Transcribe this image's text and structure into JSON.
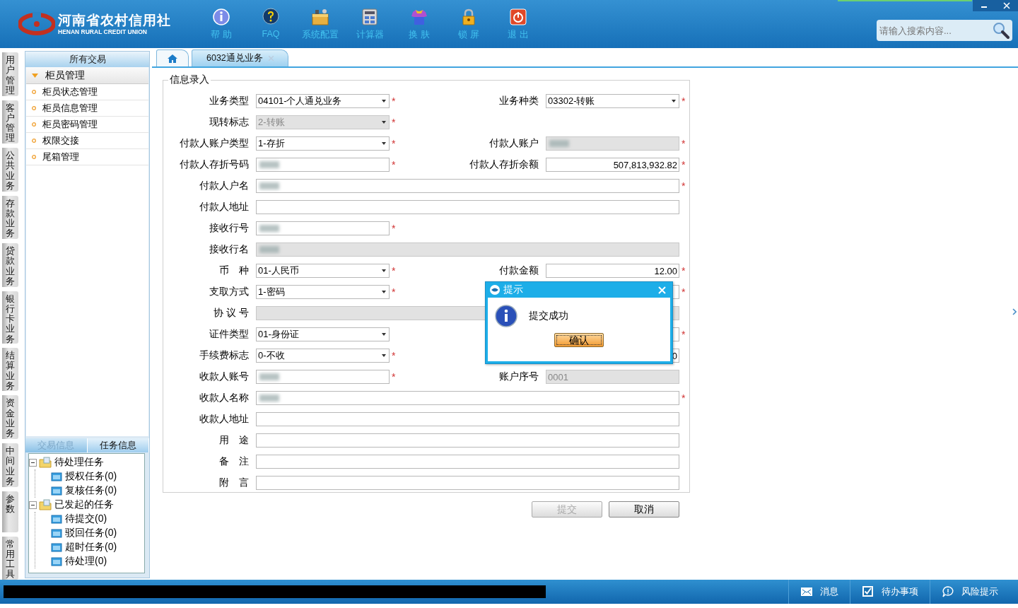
{
  "header": {
    "logo_title": "河南省农村信用社",
    "logo_subtitle": "HENAN RURAL CREDIT UNION",
    "toolbar": [
      {
        "label": "帮 助"
      },
      {
        "label": "FAQ"
      },
      {
        "label": "系统配置"
      },
      {
        "label": "计算器"
      },
      {
        "label": "换 肤"
      },
      {
        "label": "锁 屏"
      },
      {
        "label": "退 出"
      }
    ],
    "search": {
      "placeholder": "请输入搜索内容..."
    }
  },
  "side_tabs": [
    {
      "label": "用户管理"
    },
    {
      "label": "客户管理"
    },
    {
      "label": "公共业务"
    },
    {
      "label": "存款业务"
    },
    {
      "label": "贷款业务"
    },
    {
      "label": "银行卡业务"
    },
    {
      "label": "结算业务"
    },
    {
      "label": "资金业务"
    },
    {
      "label": "中间业务"
    },
    {
      "label": "参数"
    },
    {
      "label": "常用工具"
    }
  ],
  "nav": {
    "title": "所有交易",
    "group": {
      "label": "柜员管理",
      "expanded": true,
      "items": [
        {
          "label": "柜员状态管理"
        },
        {
          "label": "柜员信息管理"
        },
        {
          "label": "柜员密码管理"
        },
        {
          "label": "权限交接"
        },
        {
          "label": "尾箱管理"
        }
      ]
    }
  },
  "bottom_tabs": [
    {
      "label": "交易信息",
      "selected": false
    },
    {
      "label": "任务信息",
      "selected": true
    }
  ],
  "task_tree": [
    {
      "label": "待处理任务",
      "expanded": true,
      "children": [
        {
          "label": "授权任务(0)"
        },
        {
          "label": "复核任务(0)"
        }
      ]
    },
    {
      "label": "已发起的任务",
      "expanded": true,
      "children": [
        {
          "label": "待提交(0)"
        },
        {
          "label": "驳回任务(0)"
        },
        {
          "label": "超时任务(0)"
        },
        {
          "label": "待处理(0)"
        }
      ]
    }
  ],
  "tabs": [
    {
      "kind": "home",
      "selected": false
    },
    {
      "kind": "page",
      "label": "6032通兑业务",
      "selected": true
    }
  ],
  "form": {
    "legend": "信息录入",
    "rows": [
      {
        "kind": "pair",
        "left": {
          "label": "业务类型",
          "kind": "select",
          "value": "04101-个人通兑业务",
          "required_mark": "*",
          "disabled": false
        },
        "right": {
          "label": "业务种类",
          "kind": "select",
          "value": "03302-转账",
          "required_mark": "*",
          "disabled": false
        }
      },
      {
        "kind": "pair",
        "left": {
          "label": "现转标志",
          "kind": "select",
          "value": "2-转账",
          "required_mark": "*",
          "disabled": true
        }
      },
      {
        "kind": "pair",
        "left": {
          "label": "付款人账户类型",
          "kind": "select",
          "value": "1-存折",
          "required_mark": "*",
          "disabled": false
        },
        "right": {
          "label": "付款人账户",
          "kind": "text",
          "blurred": true,
          "required_mark": "*",
          "disabled": true
        }
      },
      {
        "kind": "pair",
        "left": {
          "label": "付款人存折号码",
          "kind": "text",
          "blurred": true,
          "required_mark": "*",
          "disabled": false
        },
        "right": {
          "label": "付款人存折余额",
          "kind": "amount",
          "value": "507,813,932.82",
          "required_mark": "*",
          "disabled": false
        }
      },
      {
        "kind": "wide",
        "field": {
          "label": "付款人户名",
          "kind": "text",
          "blurred": true,
          "required_mark": "*",
          "disabled": false
        }
      },
      {
        "kind": "wide",
        "field": {
          "label": "付款人地址",
          "kind": "text",
          "disabled": false
        }
      },
      {
        "kind": "pair",
        "left": {
          "label": "接收行号",
          "kind": "text",
          "blurred": true,
          "required_mark": "*",
          "disabled": false
        }
      },
      {
        "kind": "wide",
        "field": {
          "label": "接收行名",
          "kind": "text",
          "blurred": true,
          "disabled": true
        }
      },
      {
        "kind": "pair",
        "left": {
          "label": "币　种",
          "kind": "select",
          "value": "01-人民币",
          "required_mark": "*",
          "disabled": false
        },
        "right": {
          "label": "付款金额",
          "kind": "amount",
          "value": "12.00",
          "required_mark": "*",
          "disabled": false
        }
      },
      {
        "kind": "pair",
        "left": {
          "label": "支取方式",
          "kind": "select",
          "value": "1-密码",
          "required_mark": "*",
          "disabled": false
        },
        "right": {
          "kind": "text",
          "required_mark": "*",
          "disabled": false
        }
      },
      {
        "kind": "wide",
        "field": {
          "label": "协 议 号",
          "kind": "text",
          "disabled": true
        }
      },
      {
        "kind": "pair",
        "left": {
          "label": "证件类型",
          "kind": "select",
          "value": "01-身份证",
          "disabled": false
        },
        "right": {
          "kind": "text",
          "required_mark": "*",
          "disabled": false
        }
      },
      {
        "kind": "pair",
        "left": {
          "label": "手续费标志",
          "kind": "select",
          "value": "0-不收",
          "required_mark": "*",
          "disabled": false
        },
        "right": {
          "kind": "amount",
          "value": "0",
          "disabled": false
        }
      },
      {
        "kind": "pair",
        "left": {
          "label": "收款人账号",
          "kind": "text",
          "blurred": true,
          "required_mark": "*",
          "disabled": false
        },
        "right": {
          "label": "账户序号",
          "kind": "text",
          "value": "0001",
          "disabled": true
        }
      },
      {
        "kind": "wide",
        "field": {
          "label": "收款人名称",
          "kind": "text",
          "blurred": true,
          "required_mark": "*",
          "disabled": false
        }
      },
      {
        "kind": "wide",
        "field": {
          "label": "收款人地址",
          "kind": "text",
          "disabled": false
        }
      },
      {
        "kind": "wide",
        "field": {
          "label": "用　途",
          "kind": "text",
          "disabled": false
        }
      },
      {
        "kind": "wide",
        "field": {
          "label": "备　注",
          "kind": "text",
          "disabled": false
        }
      },
      {
        "kind": "wide",
        "field": {
          "label": "附　言",
          "kind": "text",
          "disabled": false
        }
      }
    ]
  },
  "buttons": [
    {
      "label": "提交",
      "disabled": true
    },
    {
      "label": "取消",
      "disabled": false
    }
  ],
  "dialog": {
    "title": "提示",
    "message": "提交成功",
    "button": "确认"
  },
  "status_bar": [
    {
      "label": "消息"
    },
    {
      "label": "待办事项"
    },
    {
      "label": "风险提示"
    }
  ]
}
